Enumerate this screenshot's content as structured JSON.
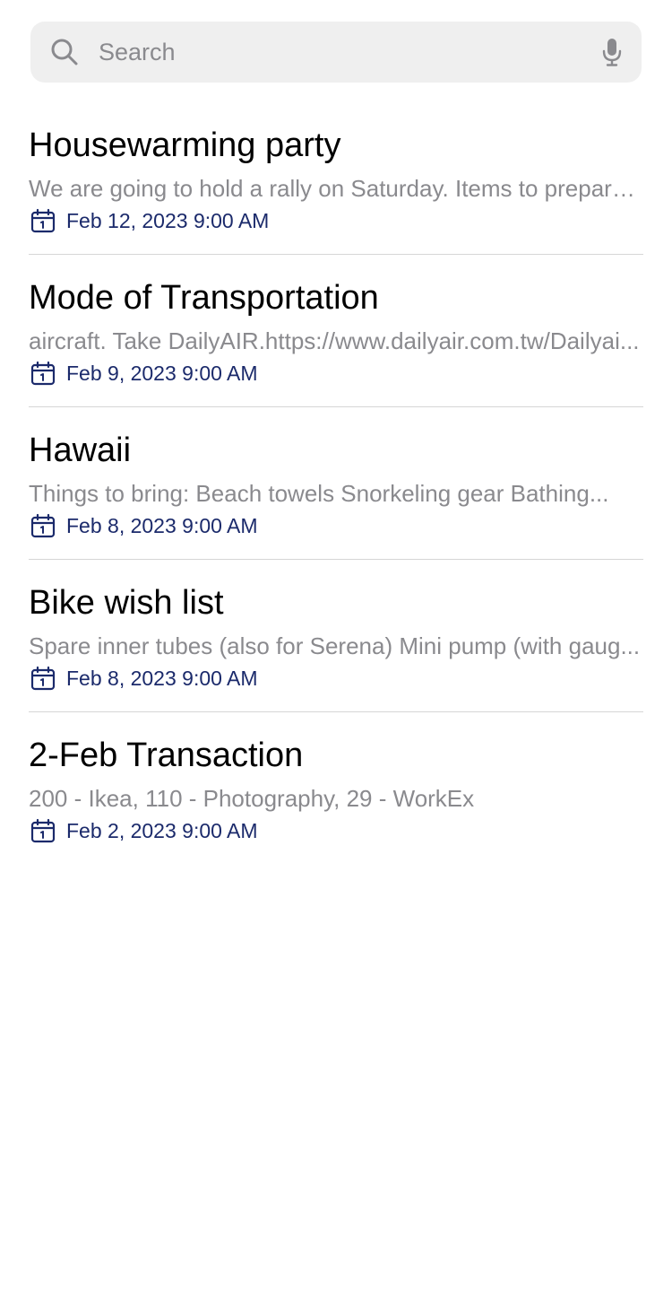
{
  "search": {
    "placeholder": "Search",
    "value": "",
    "left_icon": "search-icon",
    "right_icon": "microphone-icon"
  },
  "colors": {
    "title": "#000000",
    "preview": "#8a8a8e",
    "date": "#1b2a6b",
    "search_background": "#efefef",
    "divider": "#d6d6d6"
  },
  "notes": [
    {
      "title": "Housewarming party",
      "preview": "We are going to hold a rally on Saturday. Items to prepare....",
      "date": "Feb 12, 2023 9:00 AM",
      "icon": "calendar-icon"
    },
    {
      "title": "Mode of Transportation",
      "preview": "aircraft. Take DailyAIR.https://www.dailyair.com.tw/Dailyai...",
      "date": "Feb 9, 2023 9:00 AM",
      "icon": "calendar-icon"
    },
    {
      "title": "Hawaii",
      "preview": "Things to bring: Beach towels Snorkeling gear Bathing...",
      "date": "Feb 8, 2023 9:00 AM",
      "icon": "calendar-icon"
    },
    {
      "title": "Bike wish list",
      "preview": "Spare inner tubes (also for Serena) Mini pump (with gaug...",
      "date": "Feb 8, 2023 9:00 AM",
      "icon": "calendar-icon"
    },
    {
      "title": "2-Feb Transaction",
      "preview": "200 - Ikea, 110 - Photography, 29 - WorkEx",
      "date": "Feb 2, 2023 9:00 AM",
      "icon": "calendar-icon"
    }
  ]
}
